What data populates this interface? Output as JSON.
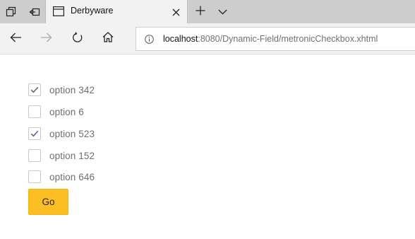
{
  "browser": {
    "tab": {
      "title": "Derbyware"
    },
    "address": {
      "host": "localhost",
      "path": ":8080/Dynamic-Field/metronicCheckbox.xhtml"
    },
    "icons": [
      "tab-actions-icon",
      "set-aside-tabs-icon",
      "page-favicon-icon",
      "close-icon",
      "plus-icon",
      "chevron-down-icon",
      "back-arrow-icon",
      "forward-arrow-icon",
      "refresh-icon",
      "home-icon",
      "info-icon"
    ]
  },
  "form": {
    "options": [
      {
        "label": "option 342",
        "checked": true
      },
      {
        "label": "option 6",
        "checked": false
      },
      {
        "label": "option 523",
        "checked": true
      },
      {
        "label": "option 152",
        "checked": false
      },
      {
        "label": "option 646",
        "checked": false
      }
    ],
    "go_label": "Go"
  },
  "colors": {
    "accent": "#fbbf24",
    "check": "#5a6a8a",
    "tabstrip": "#cdcdcd",
    "toolbar": "#f2f2f2"
  }
}
